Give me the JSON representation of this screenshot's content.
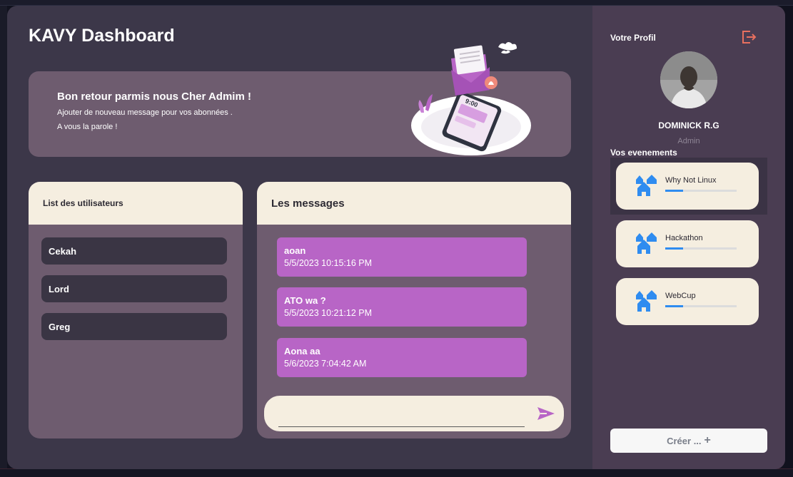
{
  "app": {
    "title": "KAVY Dashboard"
  },
  "banner": {
    "title": "Bon retour parmis nous Cher Admim !",
    "line1": "Ajouter de nouveau message pour vos abonnées .",
    "line2": "A vous la parole !",
    "illustration": "phone-with-envelope-illustration",
    "phone_time": "9:00"
  },
  "users_panel": {
    "title": "List des utilisateurs",
    "items": [
      {
        "label": "Cekah"
      },
      {
        "label": "Lord"
      },
      {
        "label": "Greg"
      }
    ]
  },
  "messages_panel": {
    "title": "Les messages",
    "items": [
      {
        "text": "aoan",
        "time": "5/5/2023 10:15:16 PM"
      },
      {
        "text": "ATO wa ?",
        "time": "5/5/2023 10:21:12 PM"
      },
      {
        "text": "Aona aa",
        "time": "5/6/2023 7:04:42 AM"
      }
    ],
    "composer": {
      "value": "",
      "placeholder": ""
    },
    "send_icon": "send-icon"
  },
  "profile": {
    "title": "Votre Profil",
    "name": "DOMINICK R.G",
    "role": "Admin",
    "logout_icon": "logout-icon"
  },
  "events": {
    "title": "Vos evenements",
    "items": [
      {
        "name": "Why Not Linux",
        "progress": 0.25,
        "icon": "houses-icon"
      },
      {
        "name": "Hackathon",
        "progress": 0.25,
        "icon": "houses-icon"
      },
      {
        "name": "WebCup",
        "progress": 0.25,
        "icon": "houses-icon"
      }
    ],
    "selected_index": 0
  },
  "create_button": {
    "label": "Créer ...",
    "icon": "+"
  },
  "colors": {
    "window_bg": "#3c3749",
    "card_bg": "#6e5c6f",
    "cream": "#f5eee0",
    "message_bubble": "#b865c6",
    "sidebar_bg": "#4a3d52",
    "accent_blue": "#2f8cf0",
    "logout_red": "#e8705f"
  }
}
